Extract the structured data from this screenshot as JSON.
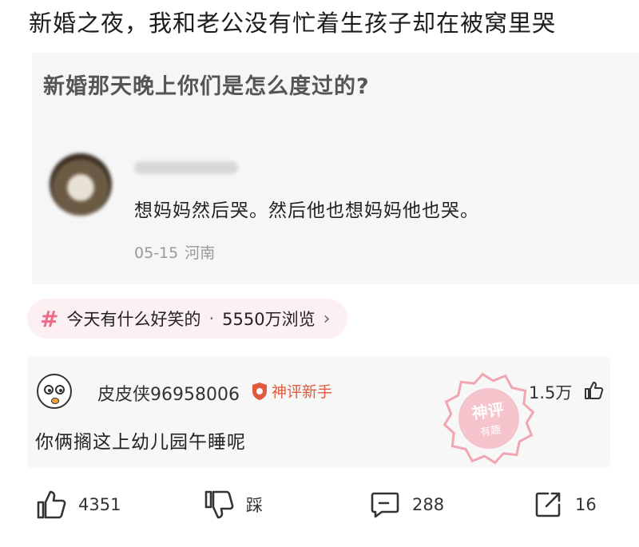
{
  "post": {
    "title": "新婚之夜，我和老公没有忙着生孩子却在被窝里哭"
  },
  "quote": {
    "question": "新婚那天晚上你们是怎么度过的?",
    "answer": "想妈妈然后哭。然后他也想妈妈他也哭。",
    "date": "05-15",
    "location": "河南"
  },
  "topic": {
    "hash_icon": "hash-icon",
    "name": "今天有什么好笑的",
    "separator": "·",
    "views": "5550万浏览",
    "chevron": "›"
  },
  "comment": {
    "username": "皮皮侠96958006",
    "badge": "神评新手",
    "stamp_text": [
      "神评",
      "有趣"
    ],
    "likes": "1.5万",
    "text": "你俩搁这上幼儿园午睡呢"
  },
  "actions": {
    "like_count": "4351",
    "dislike_label": "踩",
    "comment_count": "288",
    "share_count": "16"
  },
  "colors": {
    "accent_pink": "#f06a8a",
    "badge_orange": "#e05a3c",
    "pill_bg": "#fdf0f2"
  }
}
